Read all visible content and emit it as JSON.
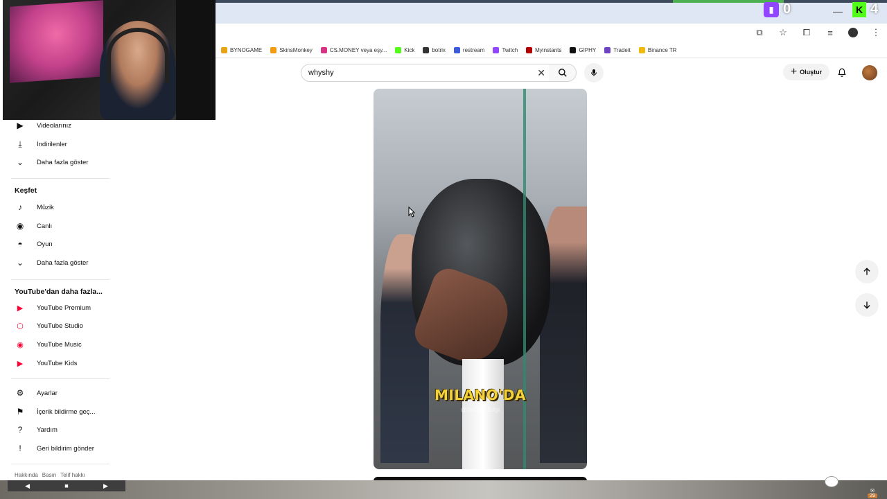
{
  "browser": {
    "overlay_twitch_count": "0",
    "overlay_kick_count": "4",
    "bookmarks": [
      {
        "label": "BYNOGAME",
        "color": "#e8a317"
      },
      {
        "label": "SkinsMonkey",
        "color": "#f39c12"
      },
      {
        "label": "CS.MONEY veya eşy...",
        "color": "#d63384"
      },
      {
        "label": "Kick",
        "color": "#53fc18"
      },
      {
        "label": "botrix",
        "color": "#333333"
      },
      {
        "label": "restream",
        "color": "#3b5bdb"
      },
      {
        "label": "Twitch",
        "color": "#9146ff"
      },
      {
        "label": "Myinstants",
        "color": "#b30000"
      },
      {
        "label": "GIPHY",
        "color": "#111111"
      },
      {
        "label": "Tradeit",
        "color": "#6f42c1"
      },
      {
        "label": "Binance TR",
        "color": "#f0b90b"
      }
    ]
  },
  "youtube": {
    "search": {
      "value": "whyshy"
    },
    "create_label": "Oluştur"
  },
  "sidebar": {
    "top_items": [
      {
        "label": "Videolarınız",
        "icon": "play-square-icon"
      },
      {
        "label": "İndirilenler",
        "icon": "download-icon"
      },
      {
        "label": "Daha fazla göster",
        "icon": "chevron-down-icon"
      }
    ],
    "explore_heading": "Keşfet",
    "explore_items": [
      {
        "label": "Müzik",
        "icon": "music-note-icon"
      },
      {
        "label": "Canlı",
        "icon": "live-icon"
      },
      {
        "label": "Oyun",
        "icon": "gamepad-icon"
      },
      {
        "label": "Daha fazla göster",
        "icon": "chevron-down-icon"
      }
    ],
    "more_heading": "YouTube'dan daha fazla...",
    "more_items": [
      {
        "label": "YouTube Premium",
        "icon": "youtube-premium-icon"
      },
      {
        "label": "YouTube Studio",
        "icon": "youtube-studio-icon"
      },
      {
        "label": "YouTube Music",
        "icon": "youtube-music-icon"
      },
      {
        "label": "YouTube Kids",
        "icon": "youtube-kids-icon"
      }
    ],
    "settings_items": [
      {
        "label": "Ayarlar",
        "icon": "gear-icon"
      },
      {
        "label": "İçerik bildirme geç...",
        "icon": "flag-icon"
      },
      {
        "label": "Yardım",
        "icon": "help-icon"
      },
      {
        "label": "Geri bildirim gönder",
        "icon": "feedback-icon"
      }
    ],
    "footer": [
      "Hakkında",
      "Basın",
      "Telif hakkı"
    ]
  },
  "video": {
    "caption": "MILANO'DA",
    "watermark": "@Şu3ah-Bdgi"
  },
  "taskbar": {
    "mail_count": "29"
  },
  "colors": {
    "youtube_red": "#ff0033",
    "twitch_purple": "#9146ff",
    "kick_green": "#53fc18"
  }
}
